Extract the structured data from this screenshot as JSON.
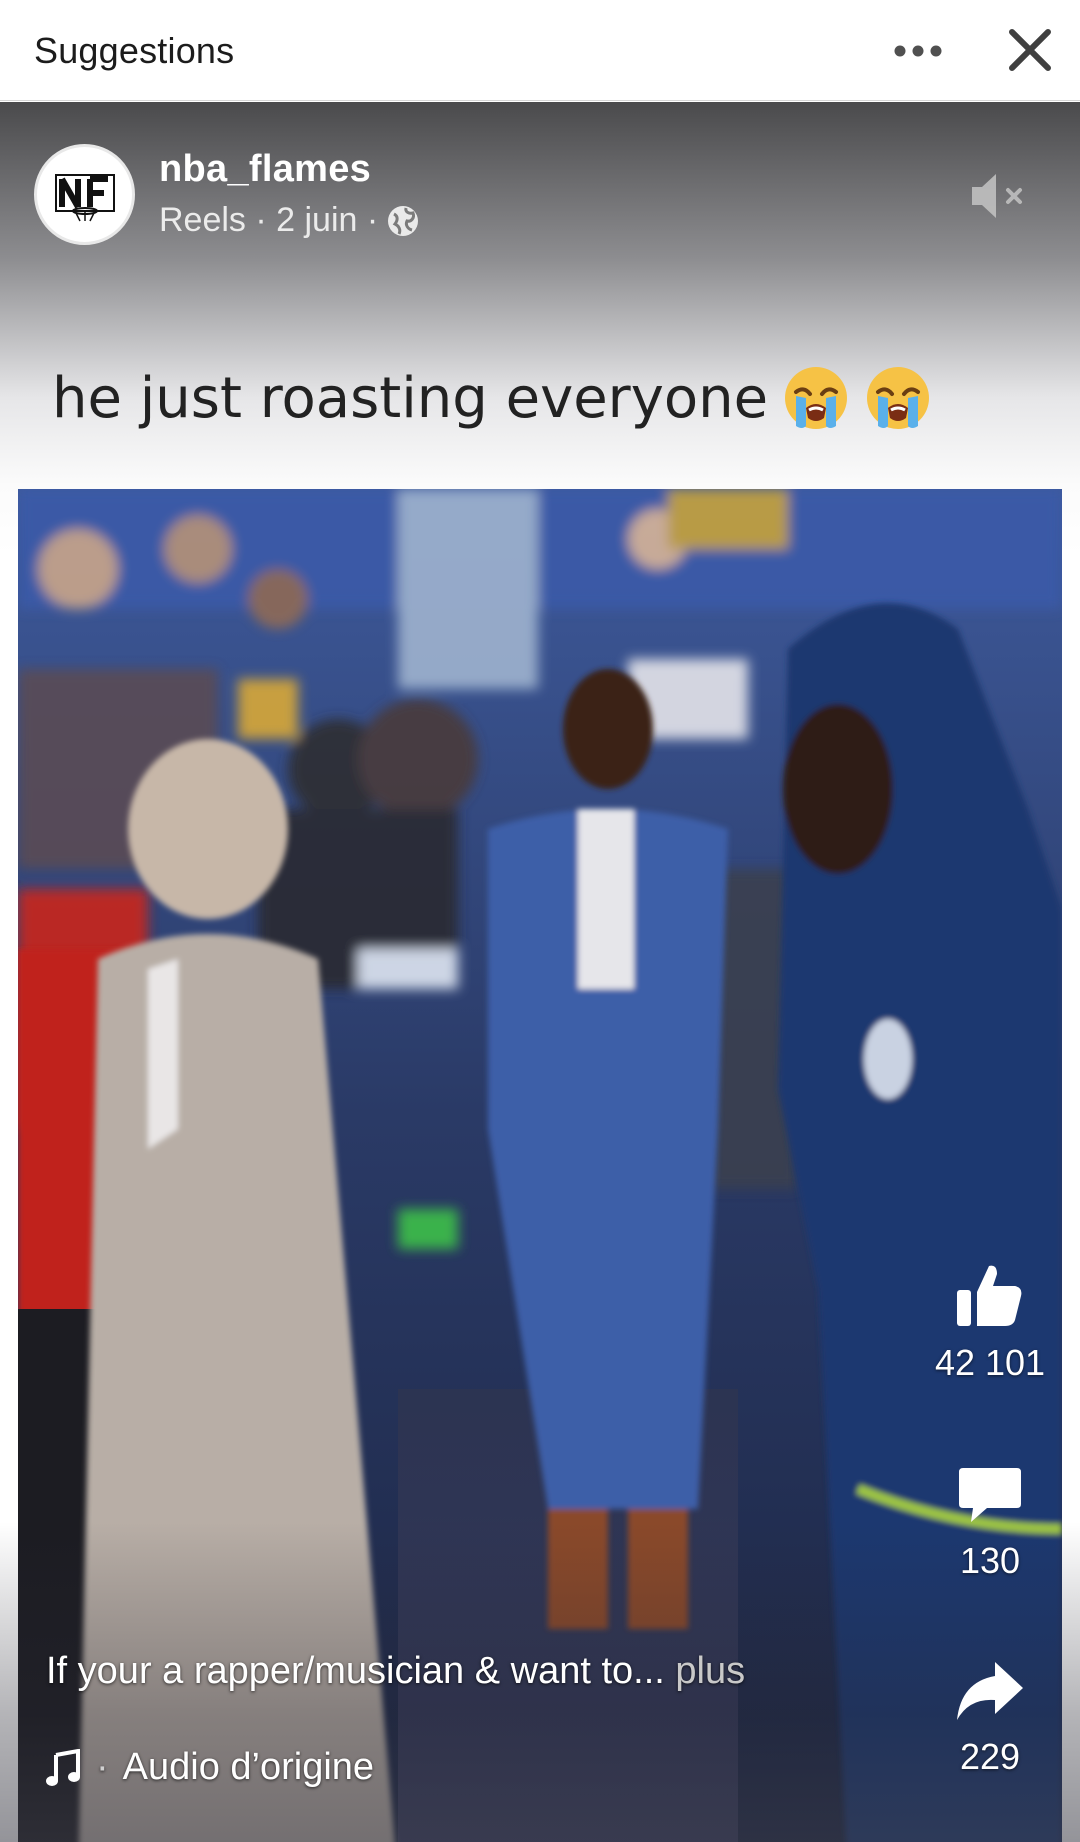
{
  "header": {
    "title": "Suggestions",
    "more_icon": "more-horizontal-icon",
    "close_icon": "close-icon"
  },
  "post": {
    "author": "nba_flames",
    "avatar_text": "NF",
    "meta": "Reels · 2 juin ·",
    "privacy_icon": "globe-icon",
    "mute_icon": "speaker-muted-icon",
    "overlay_text": "he just roasting everyone",
    "overlay_emoji": "loudly-crying-face",
    "likes": "42 101",
    "comments": "130",
    "shares": "229",
    "caption": "If your a rapper/musician & want to...",
    "caption_more": "plus",
    "audio_separator": "·",
    "audio": "Audio d’origine"
  },
  "colors": {
    "accent_white": "#ffffff",
    "muted_text": "#c9c9c9"
  }
}
